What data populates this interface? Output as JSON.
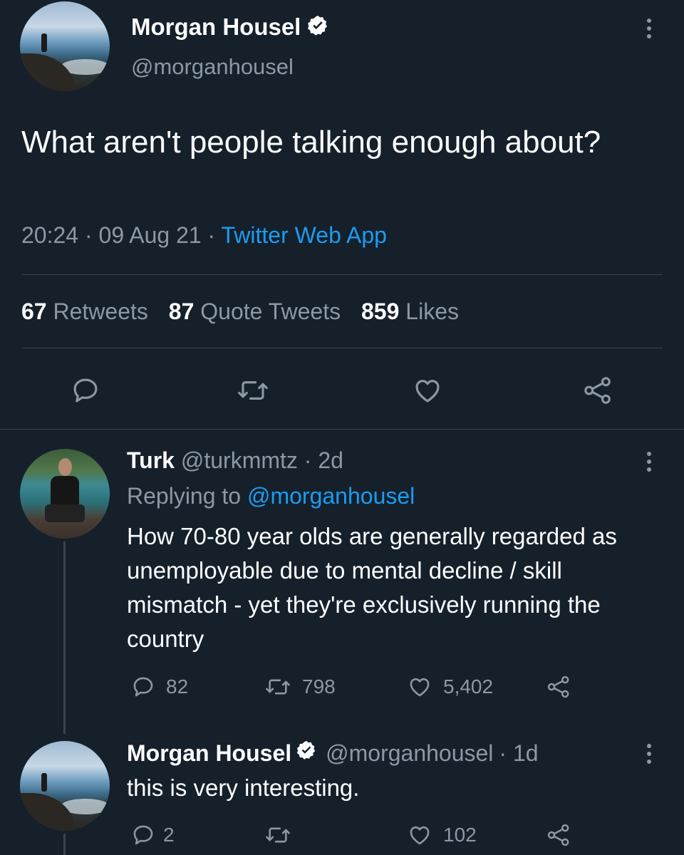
{
  "tweet": {
    "author_name": "Morgan Housel",
    "author_handle": "@morganhousel",
    "text": "What aren't people talking enough about?",
    "time": "20:24",
    "date": "09 Aug 21",
    "separator": "·",
    "source": "Twitter Web App",
    "stats": {
      "retweets_count": "67",
      "retweets_label": "Retweets",
      "quotes_count": "87",
      "quotes_label": "Quote Tweets",
      "likes_count": "859",
      "likes_label": "Likes"
    }
  },
  "replies": [
    {
      "author_name": "Turk",
      "author_handle": "@turkmmtz",
      "age": "· 2d",
      "replying_prefix": "Replying to",
      "replying_handle": "@morganhousel",
      "text": "How 70-80 year olds are generally regarded as unemployable due to mental decline / skill mismatch - yet they're exclusively running the country",
      "reply_count": "82",
      "retweet_count": "798",
      "like_count": "5,402"
    },
    {
      "author_name": "Morgan Housel",
      "author_handle": "@morganhousel",
      "age": "· 1d",
      "text": "this is very interesting.",
      "reply_count": "2",
      "retweet_count": "",
      "like_count": "102"
    }
  ],
  "icons": {
    "reply": "reply-icon",
    "retweet": "retweet-icon",
    "like": "heart-icon",
    "share": "share-icon",
    "verified": "verified-badge-icon",
    "more": "more-vertical-icon"
  },
  "colors": {
    "background": "#15202b",
    "text": "#ffffff",
    "muted": "#8b98a5",
    "accent": "#1d9bf0",
    "divider": "#38444d"
  }
}
